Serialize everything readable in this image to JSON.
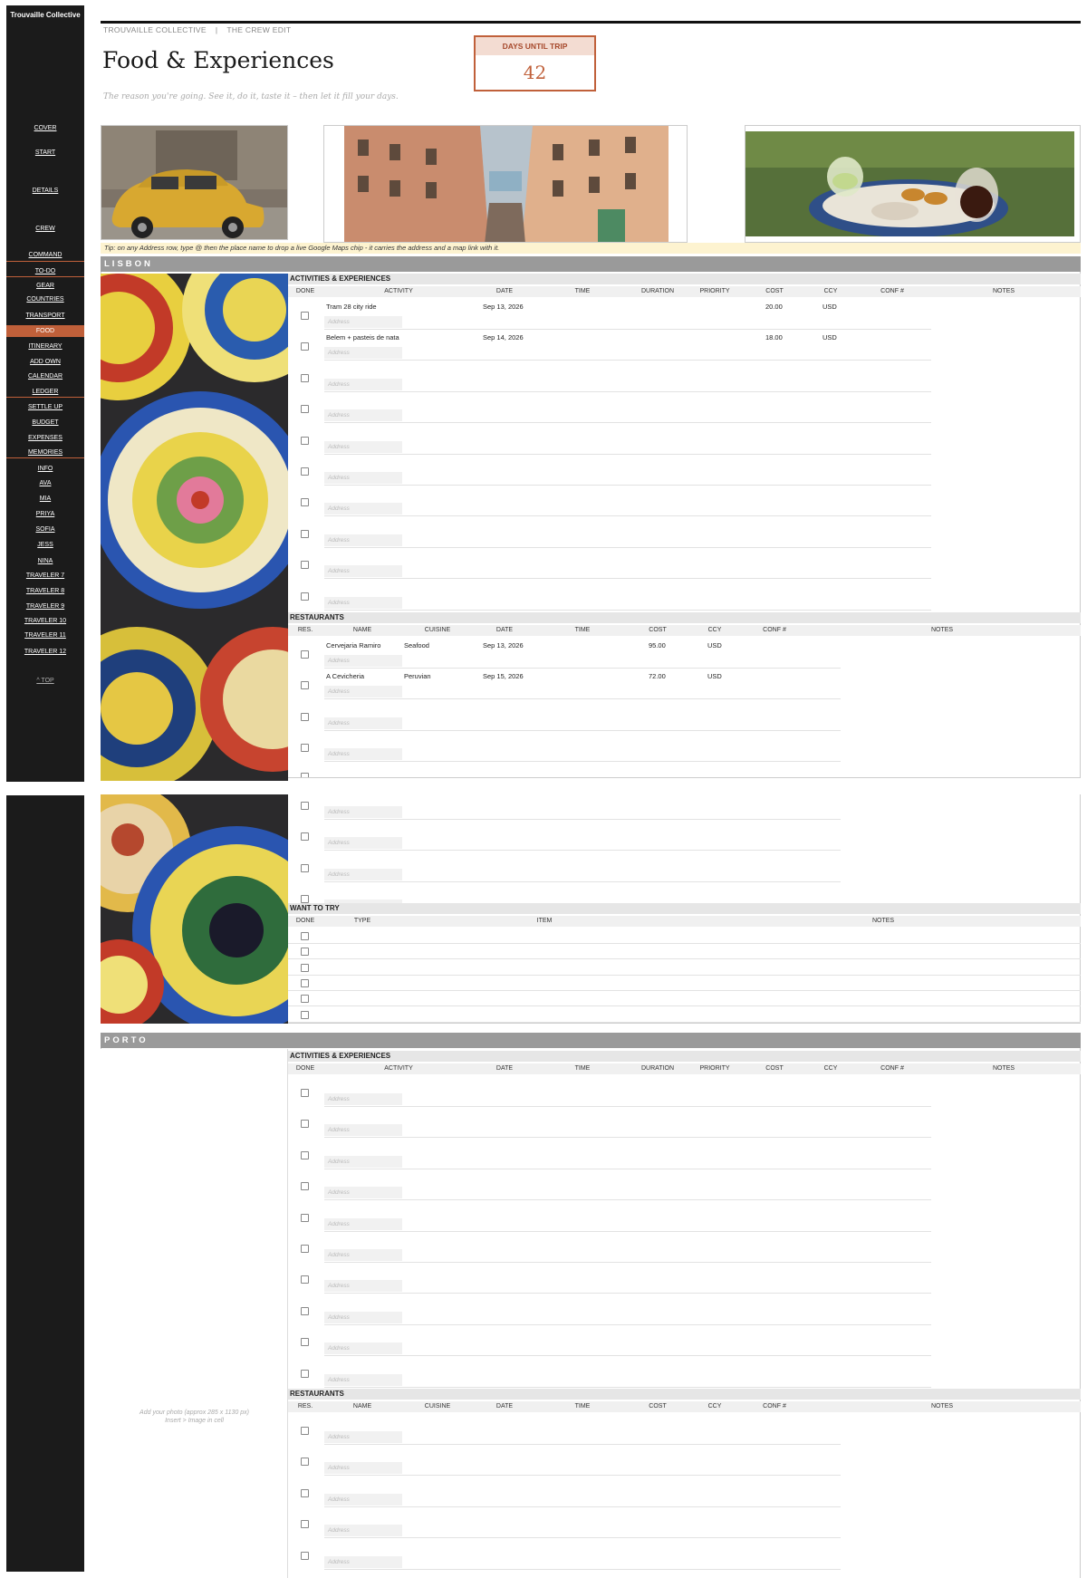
{
  "brand": "Trouvaille Collective",
  "nav": {
    "items": [
      {
        "label": "COVER"
      },
      {
        "label": "START"
      },
      {
        "label": "DETAILS"
      },
      {
        "label": "CREW"
      },
      {
        "label": "COMMAND"
      },
      {
        "label": "TO-DO"
      },
      {
        "label": "GEAR"
      },
      {
        "label": "COUNTRIES"
      },
      {
        "label": "TRANSPORT"
      },
      {
        "label": "FOOD",
        "active": true
      },
      {
        "label": "ITINERARY"
      },
      {
        "label": "ADD OWN"
      },
      {
        "label": "CALENDAR"
      },
      {
        "label": "LEDGER"
      },
      {
        "label": "SETTLE UP"
      },
      {
        "label": "BUDGET"
      },
      {
        "label": "EXPENSES"
      },
      {
        "label": "MEMORIES"
      },
      {
        "label": "INFO"
      },
      {
        "label": "AVA"
      },
      {
        "label": "MIA"
      },
      {
        "label": "PRIYA"
      },
      {
        "label": "SOFIA"
      },
      {
        "label": "JESS"
      },
      {
        "label": "NINA"
      },
      {
        "label": "TRAVELER 7"
      },
      {
        "label": "TRAVELER 8"
      },
      {
        "label": "TRAVELER 9"
      },
      {
        "label": "TRAVELER 10"
      },
      {
        "label": "TRAVELER 11"
      },
      {
        "label": "TRAVELER 12"
      }
    ],
    "top_link": "^ TOP"
  },
  "header": {
    "crumb_1": "TROUVAILLE COLLECTIVE",
    "crumb_sep": "|",
    "crumb_2": "THE CREW EDIT",
    "title": "Food & Experiences",
    "subtitle": "The reason you're going. See it, do it, taste it – then let it fill your days."
  },
  "countdown": {
    "label": "DAYS UNTIL TRIP",
    "value": "42"
  },
  "photos": [
    {
      "icon": "vintage-yellow-car-photo"
    },
    {
      "icon": "narrow-lisbon-street-photo"
    },
    {
      "icon": "pastel-de-nata-table-photo"
    }
  ],
  "tip": "Tip: on any Address row, type  @  then the place name to drop a live Google Maps chip - it carries the address and a map link with it.",
  "address_placeholder": "Address",
  "activity_columns": [
    "DONE",
    "ACTIVITY",
    "DATE",
    "TIME",
    "DURATION",
    "PRIORITY",
    "COST",
    "CCY",
    "CONF #",
    "NOTES"
  ],
  "restaurant_columns": [
    "RES.",
    "NAME",
    "CUISINE",
    "DATE",
    "TIME",
    "COST",
    "CCY",
    "CONF #",
    "NOTES"
  ],
  "want_columns": [
    "DONE",
    "TYPE",
    "ITEM",
    "NOTES"
  ],
  "sections": {
    "lisbon": {
      "name": "LISBON",
      "activities_title": "ACTIVITIES & EXPERIENCES",
      "activities": [
        {
          "activity": "Tram 28 city ride",
          "date": "Sep 13, 2026",
          "cost": "20.00",
          "ccy": "USD"
        },
        {
          "activity": "Belem + pasteis de nata",
          "date": "Sep 14, 2026",
          "cost": "18.00",
          "ccy": "USD"
        }
      ],
      "restaurants_title": "RESTAURANTS",
      "restaurants": [
        {
          "name": "Cervejaria Ramiro",
          "cuisine": "Seafood",
          "date": "Sep 13, 2026",
          "cost": "95.00",
          "ccy": "USD"
        },
        {
          "name": "A Cevicheria",
          "cuisine": "Peruvian",
          "date": "Sep 15, 2026",
          "cost": "72.00",
          "ccy": "USD"
        }
      ],
      "want_title": "WANT TO TRY"
    },
    "porto": {
      "name": "PORTO",
      "activities_title": "ACTIVITIES & EXPERIENCES",
      "restaurants_title": "RESTAURANTS",
      "photo_hint_1": "Add your photo  (approx 285 x 1130 px)",
      "photo_hint_2": "Insert > Image in cell"
    }
  },
  "colors": {
    "accent": "#c0603a",
    "sidebar_bg": "#1b1b1b",
    "section_bar": "#9a9a9a",
    "tip_bg": "#fdf3d0"
  }
}
